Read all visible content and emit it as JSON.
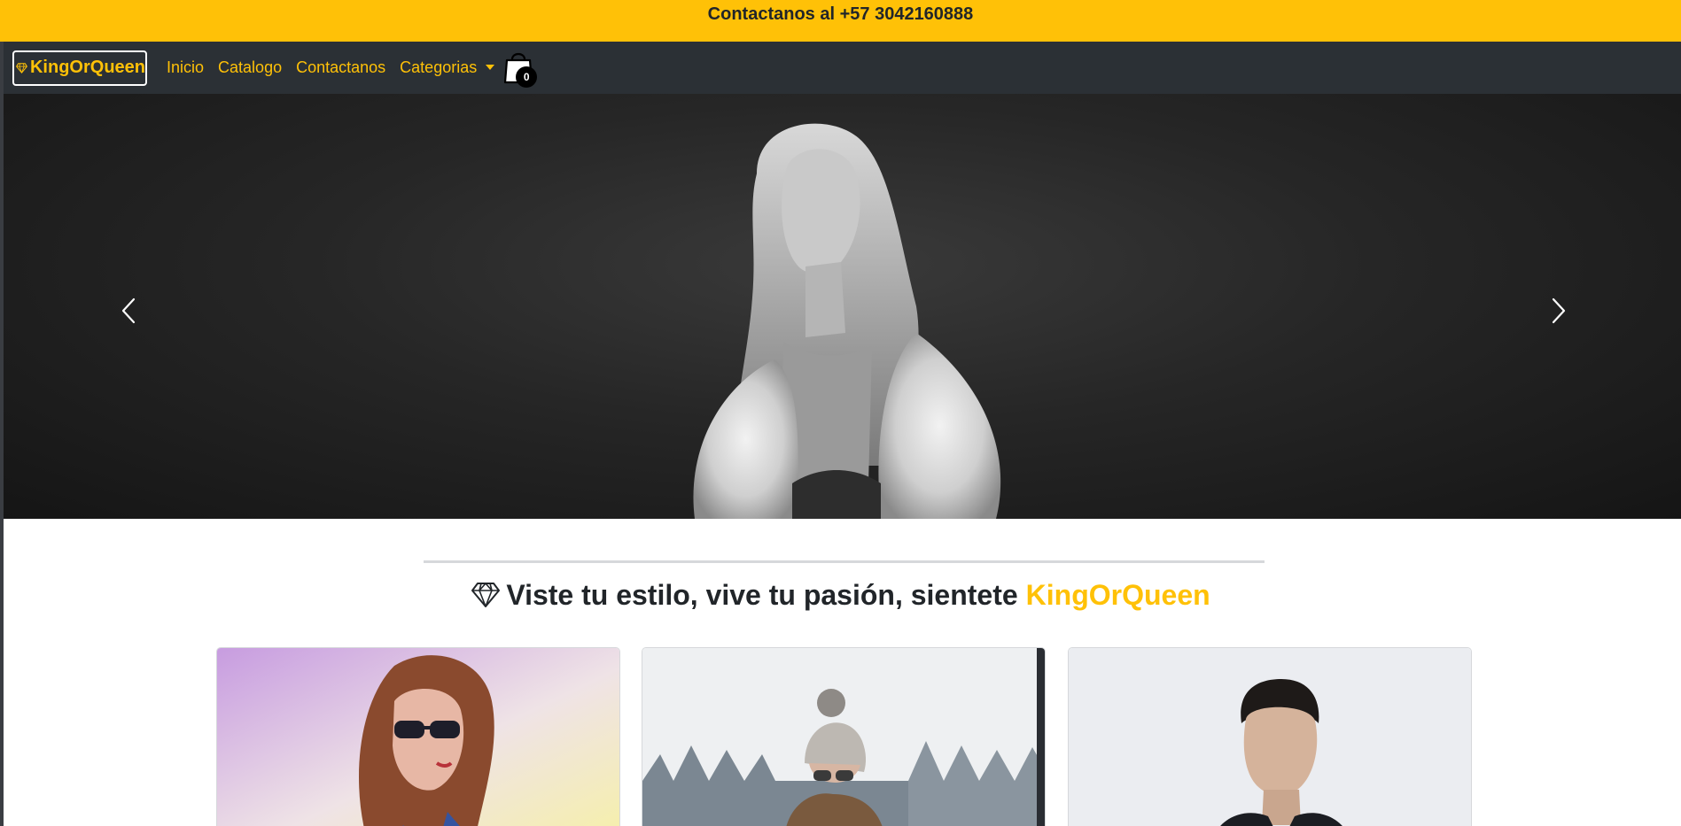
{
  "topbar": {
    "text": "Contactanos al +57 3042160888",
    "background": "#ffc107"
  },
  "navbar": {
    "brand": "KingOrQueen",
    "brand_icon": "gem-icon",
    "links": [
      "Inicio",
      "Catalogo",
      "Contactanos",
      "Categorias"
    ],
    "cart_icon": "shopping-bag-icon",
    "cart_count": "0",
    "accent": "#ffc107",
    "background": "#2b3035"
  },
  "carousel": {
    "prev_icon": "chevron-left-icon",
    "next_icon": "chevron-right-icon"
  },
  "headline": {
    "text": "Viste tu estilo, vive tu pasión, sientete",
    "brand": "KingOrQueen",
    "icon": "gem-icon"
  }
}
